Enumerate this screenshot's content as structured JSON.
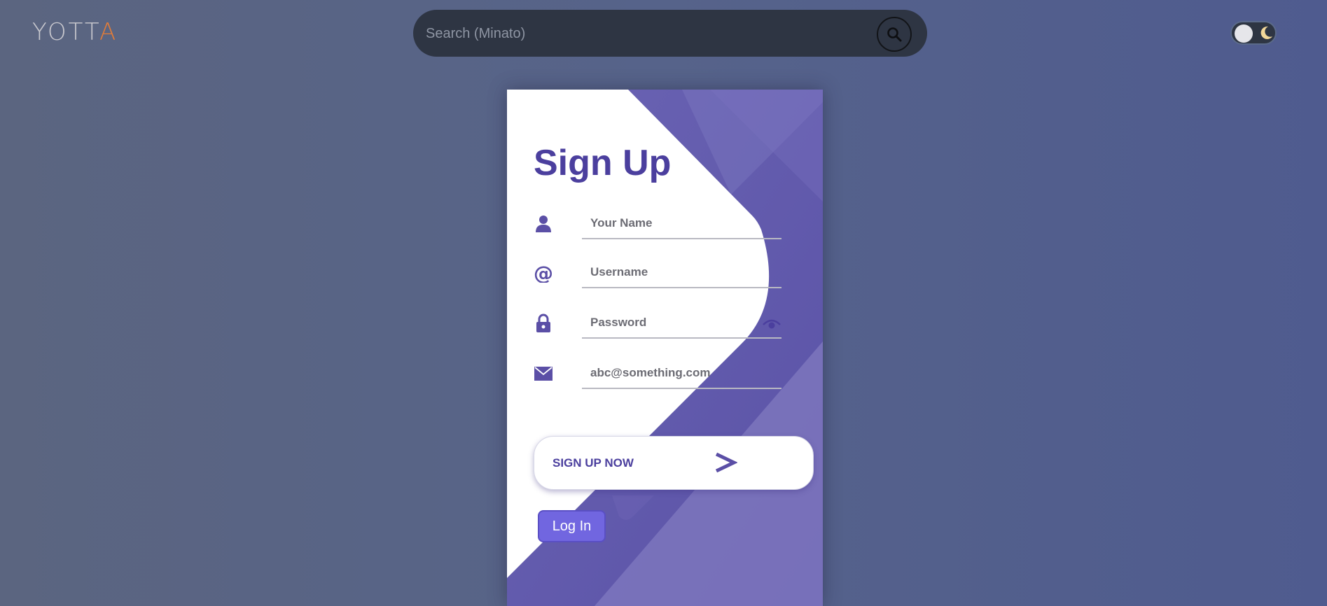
{
  "header": {
    "logo_main": "YOTT",
    "logo_accent": "A",
    "search": {
      "placeholder": "Search (Minato)",
      "icon": "search-icon"
    },
    "theme_toggle": {
      "state": "light",
      "icon": "moon-icon"
    }
  },
  "signup_form": {
    "title": "Sign Up",
    "fields": [
      {
        "icon": "user-icon",
        "placeholder": "Your Name",
        "value": ""
      },
      {
        "icon": "at-icon",
        "placeholder": "Username",
        "value": ""
      },
      {
        "icon": "lock-icon",
        "placeholder": "Password",
        "value": "",
        "toggle_icon": "eye-icon"
      },
      {
        "icon": "envelope-icon",
        "placeholder": "abc@something.com",
        "value": ""
      }
    ],
    "submit_label": "SIGN UP NOW",
    "submit_icon": "arrow-right-icon",
    "login_label": "Log In"
  },
  "colors": {
    "primary": "#4b3f9e",
    "accent_purple": "#6a5fb5",
    "login_button": "#7166e0",
    "logo_accent": "#e07c3a",
    "search_bg": "#2e3543"
  }
}
